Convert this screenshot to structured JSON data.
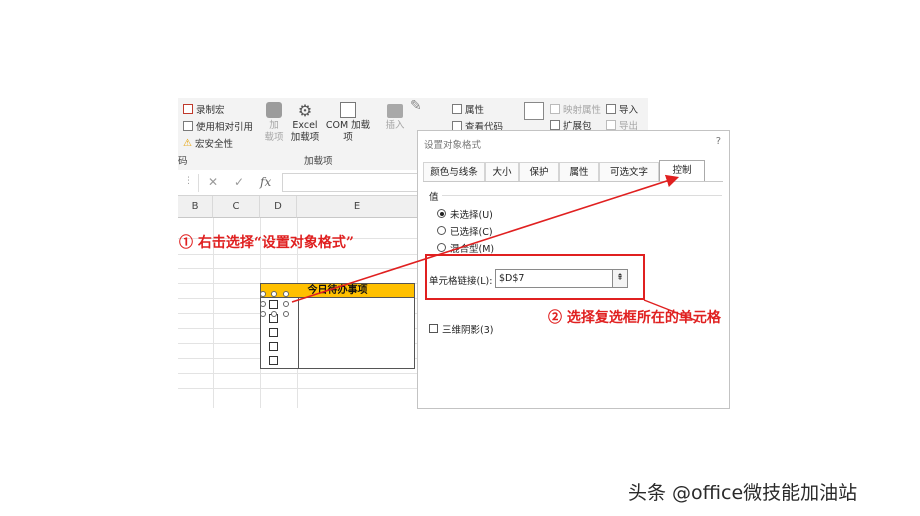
{
  "ribbon": {
    "record_macro": "录制宏",
    "relative_ref": "使用相对引用",
    "macro_security": "宏安全性",
    "code_group_fragment": "码",
    "addins_btn_line1": "加",
    "addins_btn_line2": "载项",
    "excel_addins_line1": "Excel",
    "excel_addins_line2": "加载项",
    "com_addins": "COM 加载项",
    "addins_group": "加载项",
    "insert_btn": "插入",
    "properties": "属性",
    "view_code": "查看代码",
    "map_properties": "映射属性",
    "expansion_packs": "扩展包",
    "import": "导入",
    "export": "导出"
  },
  "formula_bar": {
    "cancel_glyph": "✕",
    "enter_glyph": "✓",
    "fx_glyph": "fx"
  },
  "sheet": {
    "columns": [
      "B",
      "C",
      "D",
      "E"
    ],
    "table_title": "今日待办事项",
    "checkbox_rows": 5
  },
  "dialog": {
    "title": "设置对象格式",
    "help": "?",
    "tabs": [
      "颜色与线条",
      "大小",
      "保护",
      "属性",
      "可选文字",
      "控制"
    ],
    "active_tab": "控制",
    "value_group": "值",
    "radios": [
      "未选择(U)",
      "已选择(C)",
      "混合型(M)"
    ],
    "selected_radio": "未选择(U)",
    "cell_link_label": "单元格链接(L):",
    "cell_link_value": "$D$7",
    "shade_3d": "三维阴影(3)"
  },
  "annotations": {
    "step1": "① 右击选择“设置对象格式”",
    "step2": "② 选择复选框所在的单元格",
    "color": "#e02020"
  },
  "watermark": "头条 @office微技能加油站",
  "colors": {
    "table_header": "#ffc000",
    "accent_red": "#e02020"
  }
}
